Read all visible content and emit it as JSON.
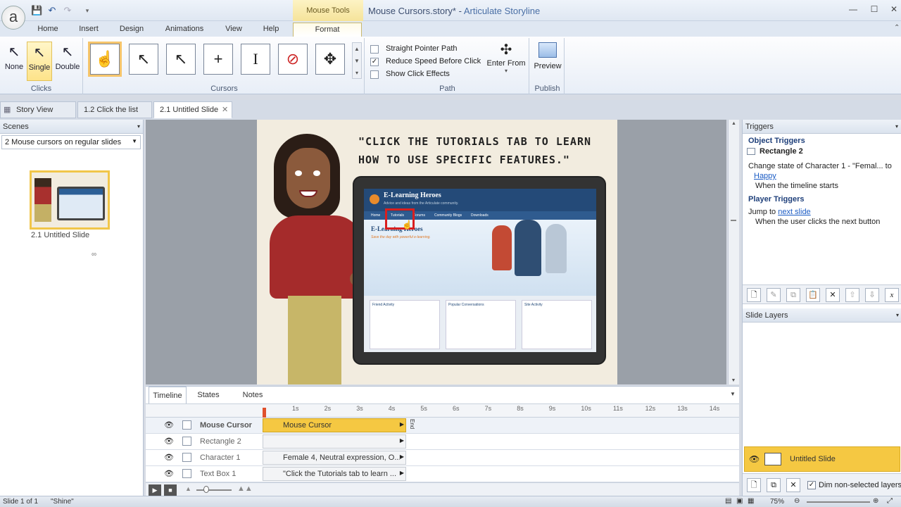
{
  "window": {
    "title": "Mouse Cursors.story*",
    "separator": " - ",
    "app_name": "Articulate Storyline",
    "contextual_tab_header": "Mouse Tools"
  },
  "ribbon": {
    "tabs": [
      "Home",
      "Insert",
      "Design",
      "Animations",
      "View",
      "Help",
      "Format"
    ],
    "clicks": {
      "label": "Clicks",
      "buttons": [
        "None",
        "Single",
        "Double"
      ],
      "selected": "Single"
    },
    "cursors": {
      "label": "Cursors"
    },
    "path": {
      "label": "Path",
      "options": [
        {
          "label": "Straight Pointer Path",
          "checked": false
        },
        {
          "label": "Reduce Speed Before Click",
          "checked": true
        },
        {
          "label": "Show Click Effects",
          "checked": false
        }
      ],
      "enter_from": "Enter From"
    },
    "publish": {
      "label": "Publish",
      "preview": "Preview"
    }
  },
  "doc_tabs": [
    "Story View",
    "1.2 Click the list",
    "2.1 Untitled Slide"
  ],
  "scenes": {
    "header": "Scenes",
    "dropdown": "2 Mouse cursors on regular slides",
    "thumb_label": "2.1 Untitled Slide"
  },
  "slide": {
    "quote": "\"CLICK THE TUTORIALS TAB TO LEARN HOW TO USE SPECIFIC FEATURES.\"",
    "site_title": "E-Learning Heroes",
    "site_tagline": "Advice and ideas from the Articulate community.",
    "nav": [
      "Home",
      "Tutorials",
      "Forums",
      "Community Blogs",
      "Downloads"
    ],
    "headline": "E-Learning Heroes",
    "subhead": "Save the day with powerful e-learning.",
    "cols": [
      "Friend Activity",
      "Popular Conversations",
      "Site Activity"
    ]
  },
  "triggers": {
    "header": "Triggers",
    "object_triggers": "Object Triggers",
    "object": "Rectangle 2",
    "t1_action": "Change state of Character 1 - \"Femal... to",
    "t1_link": "Happy",
    "t1_when": "When the timeline starts",
    "player_triggers": "Player Triggers",
    "t2_action": "Jump to",
    "t2_link": "next slide",
    "t2_when": "When the user clicks the next button"
  },
  "slide_layers": {
    "header": "Slide Layers",
    "base": "Untitled Slide",
    "dim": "Dim non-selected layers"
  },
  "timeline": {
    "tabs": [
      "Timeline",
      "States",
      "Notes"
    ],
    "ticks": [
      "1s",
      "2s",
      "3s",
      "4s",
      "5s",
      "6s",
      "7s",
      "8s",
      "9s",
      "10s",
      "11s",
      "12s",
      "13s",
      "14s"
    ],
    "end_label": "End",
    "layers": [
      {
        "name": "Mouse Cursor",
        "bar": "Mouse Cursor"
      },
      {
        "name": "Rectangle 2",
        "bar": ""
      },
      {
        "name": "Character 1",
        "bar": "Female 4, Neutral expression, O..."
      },
      {
        "name": "Text Box 1",
        "bar": "\"Click the Tutorials tab to learn ..."
      }
    ]
  },
  "status": {
    "slide": "Slide 1 of 1",
    "theme": "\"Shine\"",
    "zoom": "75%"
  },
  "colors": {
    "accent": "#f5c842",
    "link": "#1a5bc4"
  }
}
